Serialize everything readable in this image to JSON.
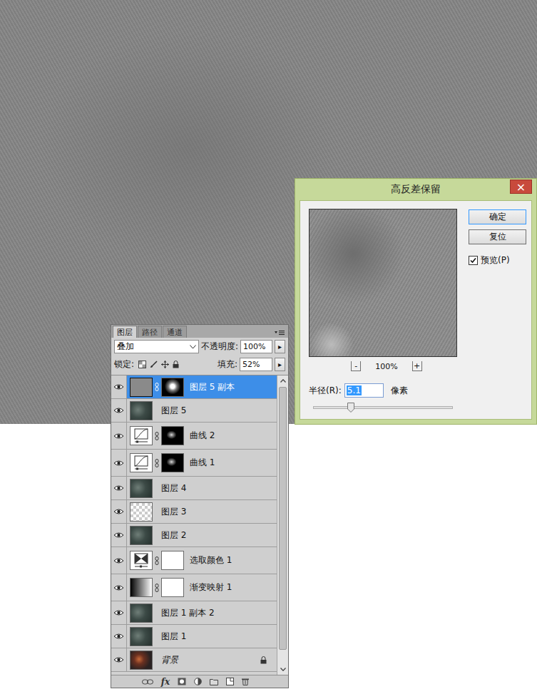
{
  "dialog": {
    "title": "高反差保留",
    "close": "×",
    "buttons": [
      {
        "label": "确定",
        "default": true
      },
      {
        "label": "复位",
        "default": false
      }
    ],
    "preview": {
      "label": "预览(P)",
      "checked": true
    },
    "zoom": {
      "minus": "-",
      "value": "100%",
      "plus": "+"
    },
    "radius": {
      "label": "半径(R):",
      "value": "5.1",
      "unit": "像素",
      "selected": true,
      "level": 0.27
    }
  },
  "layers_panel": {
    "tabs": [
      {
        "label": "图层",
        "selected": true
      },
      {
        "label": "路径",
        "selected": false
      },
      {
        "label": "通道",
        "selected": false
      }
    ],
    "blend_mode": "叠加",
    "opacity": {
      "label": "不透明度:",
      "value": "100%",
      "arrow": "▸"
    },
    "lock": {
      "label": "锁定:"
    },
    "fill": {
      "label": "填充:",
      "value": "52%",
      "arrow": "▸"
    },
    "scroll_level": 0.95,
    "layers": [
      {
        "name": "图层 5 副本",
        "kind": "highpass",
        "mask": "spot",
        "selected": true,
        "visible": true,
        "locked": false
      },
      {
        "name": "图层 5",
        "kind": "pixel",
        "mask": "none",
        "selected": false,
        "visible": true,
        "locked": false
      },
      {
        "name": "曲线 2",
        "kind": "curves",
        "mask": "curve-mask",
        "selected": false,
        "visible": true,
        "locked": false
      },
      {
        "name": "曲线 1",
        "kind": "curves",
        "mask": "curve-mask",
        "selected": false,
        "visible": true,
        "locked": false
      },
      {
        "name": "图层 4",
        "kind": "pixel",
        "mask": "none",
        "selected": false,
        "visible": true,
        "locked": false
      },
      {
        "name": "图层 3",
        "kind": "empty",
        "mask": "none",
        "selected": false,
        "visible": true,
        "locked": false
      },
      {
        "name": "图层 2",
        "kind": "pixel",
        "mask": "none",
        "selected": false,
        "visible": true,
        "locked": false
      },
      {
        "name": "选取颜色 1",
        "kind": "selective-color",
        "mask": "white",
        "selected": false,
        "visible": true,
        "locked": false
      },
      {
        "name": "渐变映射 1",
        "kind": "gradient-map",
        "mask": "white",
        "selected": false,
        "visible": true,
        "locked": false
      },
      {
        "name": "图层 1 副本 2",
        "kind": "pixel",
        "mask": "none",
        "selected": false,
        "visible": true,
        "locked": false
      },
      {
        "name": "图层 1",
        "kind": "pixel",
        "mask": "none",
        "selected": false,
        "visible": true,
        "locked": false
      },
      {
        "name": "背景",
        "kind": "background",
        "mask": "none",
        "selected": false,
        "visible": true,
        "locked": true
      }
    ],
    "footer_fx": "fx"
  }
}
